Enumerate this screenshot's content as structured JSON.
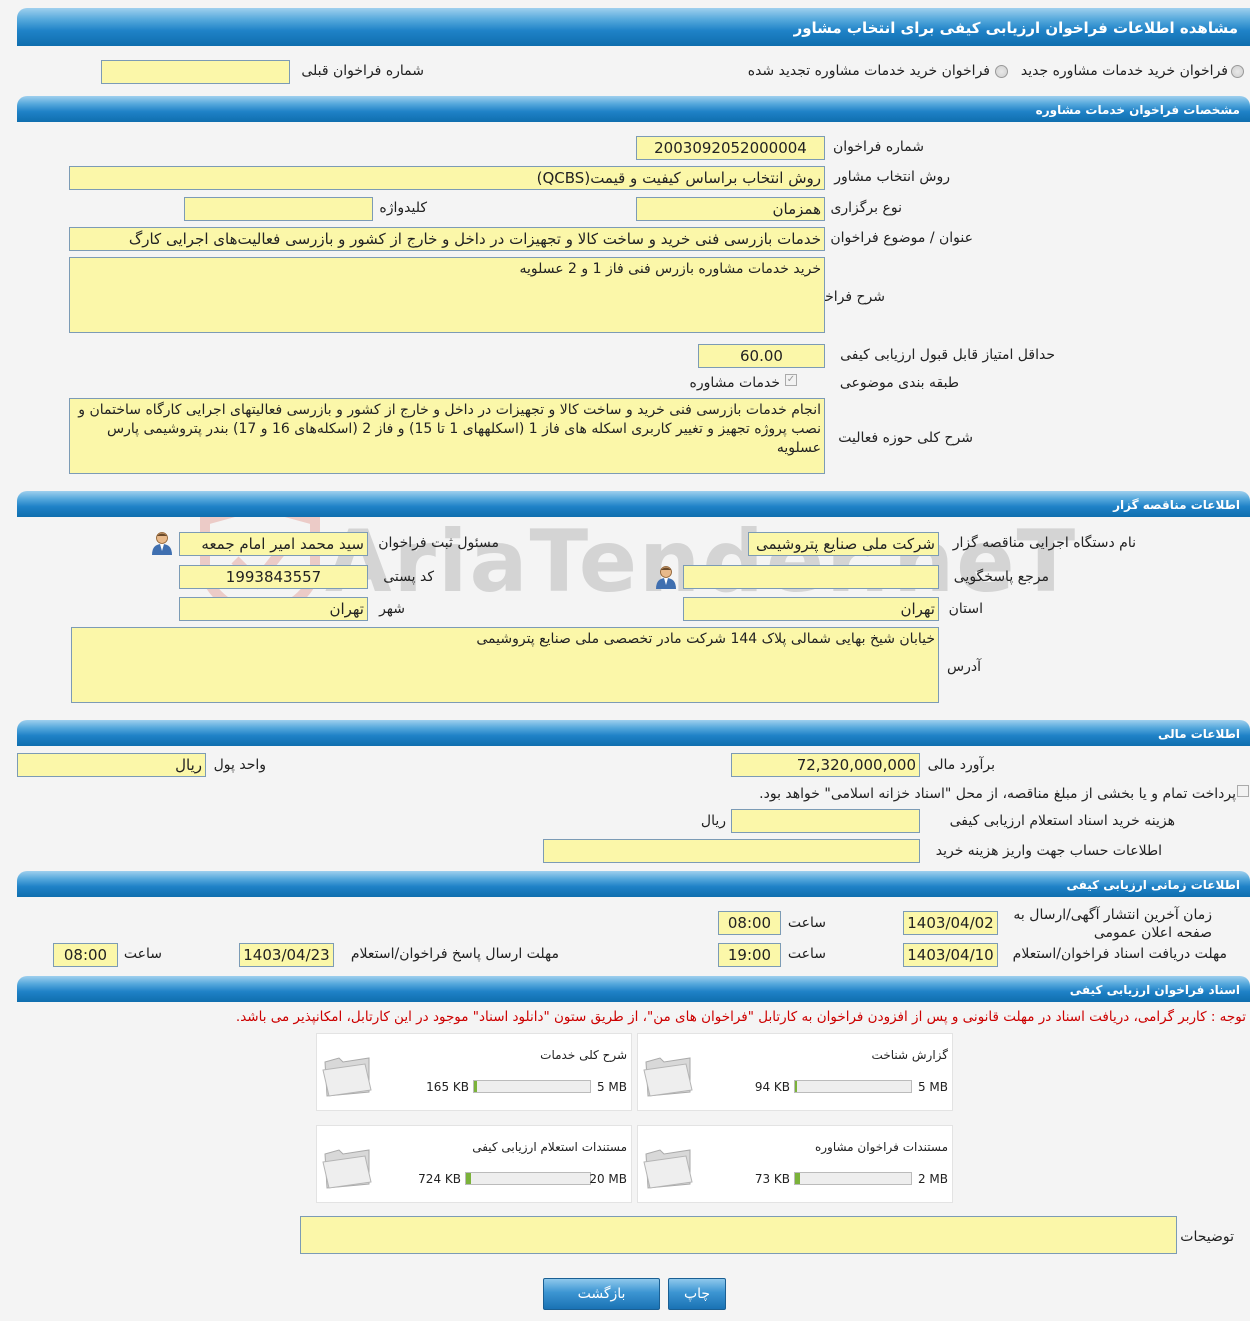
{
  "header": {
    "title": "مشاهده اطلاعات فراخوان ارزیابی کیفی برای انتخاب مشاور"
  },
  "options": {
    "radio_new": "فراخوان خرید خدمات مشاوره جدید",
    "radio_renewed": "فراخوان خرید خدمات مشاوره تجدید شده",
    "prev_number_label": "شماره فراخوان قبلی",
    "prev_number_value": ""
  },
  "spec": {
    "section_title": "مشخصات فراخوان خدمات مشاوره",
    "number_label": "شماره فراخوان",
    "number_value": "2003092052000004",
    "method_label": "روش انتخاب مشاور",
    "method_value": "روش انتخاب براساس کیفیت و قیمت(QCBS)",
    "type_label": "نوع برگزاری",
    "type_value": "همزمان",
    "keyword_label": "کلیدواژه",
    "keyword_value": "",
    "subject_label": "عنوان / موضوع فراخوان",
    "subject_value": "خدمات بازرسی فنی خرید و ساخت کالا و تجهیزات در داخل و خارج از کشور و بازرسی فعالیت‌های اجرایی کارگ",
    "desc_label": "شرح فراخوان",
    "desc_value": "خرید خدمات مشاوره بازرس فنی فاز 1 و 2 عسلویه",
    "min_score_label": "حداقل امتیاز قابل قبول ارزیابی کیفی",
    "min_score_value": "60.00",
    "category_label": "طبقه بندی موضوعی",
    "category_value": "خدمات مشاوره",
    "scope_label": "شرح کلی حوزه فعالیت",
    "scope_value": "انجام خدمات بازرسی فنی خرید و ساخت کالا و تجهیزات در داخل و خارج از کشور و بازرسی فعالیتهای اجرایی کارگاه ساختمان و نصب پروژه تجهیز و تغییر کاربری اسکله های فاز 1 (اسکلههای 1 تا 15) و فاز 2 (اسکله‌های 16 و 17) بندر پتروشیمی پارس عسلویه"
  },
  "tenderer": {
    "section_title": "اطلاعات مناقصه گزار",
    "org_label": "نام دستگاه اجرایی مناقصه گزار",
    "org_value": "شرکت ملی صنایع پتروشیمی",
    "registrar_label": "مسئول ثبت فراخوان",
    "registrar_value": "سید محمد امیر امام جمعه",
    "reference_label": "مرجع پاسخگویی",
    "reference_value": "",
    "postal_label": "کد پستی",
    "postal_value": "1993843557",
    "province_label": "استان",
    "province_value": "تهران",
    "city_label": "شهر",
    "city_value": "تهران",
    "address_label": "آدرس",
    "address_value": "خیابان شیخ بهایی شمالی پلاک 144 شرکت مادر تخصصی ملی صنایع پتروشیمی"
  },
  "financial": {
    "section_title": "اطلاعات مالی",
    "estimate_label": "برآورد مالی",
    "estimate_value": "72,320,000,000",
    "currency_label": "واحد پول",
    "currency_value": "ریال",
    "treasury_text": "پرداخت تمام و یا بخشی از مبلغ مناقصه، از محل \"اسناد خزانه اسلامی\" خواهد بود.",
    "doc_cost_label": "هزینه خرید اسناد استعلام ارزیابی کیفی",
    "doc_cost_value": "",
    "doc_cost_unit": "ریال",
    "account_label": "اطلاعات حساب جهت واریز هزینه خرید",
    "account_value": ""
  },
  "timing": {
    "section_title": "اطلاعات زمانی ارزیابی کیفی",
    "publish_label": "زمان آخرین انتشار آگهی/ارسال به صفحه اعلان عمومی",
    "publish_date": "1403/04/02",
    "time_label": "ساعت",
    "publish_time": "08:00",
    "receive_label": "مهلت دریافت اسناد فراخوان/استعلام",
    "receive_date": "1403/04/10",
    "receive_time": "19:00",
    "reply_label": "مهلت ارسال پاسخ فراخوان/استعلام",
    "reply_date": "1403/04/23",
    "reply_time": "08:00"
  },
  "documents": {
    "section_title": "اسناد فراخوان ارزیابی کیفی",
    "note": "توجه : کاربر گرامی، دریافت اسناد در مهلت قانونی و پس از افزودن فراخوان به کارتابل \"فراخوان های من\"، از طریق ستون \"دانلود اسناد\" موجود در این کارتابل، امکانپذیر می باشد.",
    "files": [
      {
        "title": "گزارش شناخت",
        "size": "94 KB",
        "max": "5 MB",
        "fraction": 0.02
      },
      {
        "title": "شرح کلی خدمات",
        "size": "165 KB",
        "max": "5 MB",
        "fraction": 0.03
      },
      {
        "title": "مستندات فراخوان مشاوره",
        "size": "73 KB",
        "max": "2 MB",
        "fraction": 0.04
      },
      {
        "title": "مستندات استعلام ارزیابی کیفی",
        "size": "724 KB",
        "max": "20 MB",
        "fraction": 0.04
      }
    ],
    "notes_label": "توضیحات",
    "notes_value": ""
  },
  "buttons": {
    "print": "چاپ",
    "back": "بازگشت"
  },
  "watermark": {
    "text": "AriaTender.neT"
  },
  "colors": {
    "field_bg": "#fbf7a9",
    "bar_blue": "#1f82c7",
    "note_red": "#cc0000",
    "progress_green": "#7bb23a"
  }
}
